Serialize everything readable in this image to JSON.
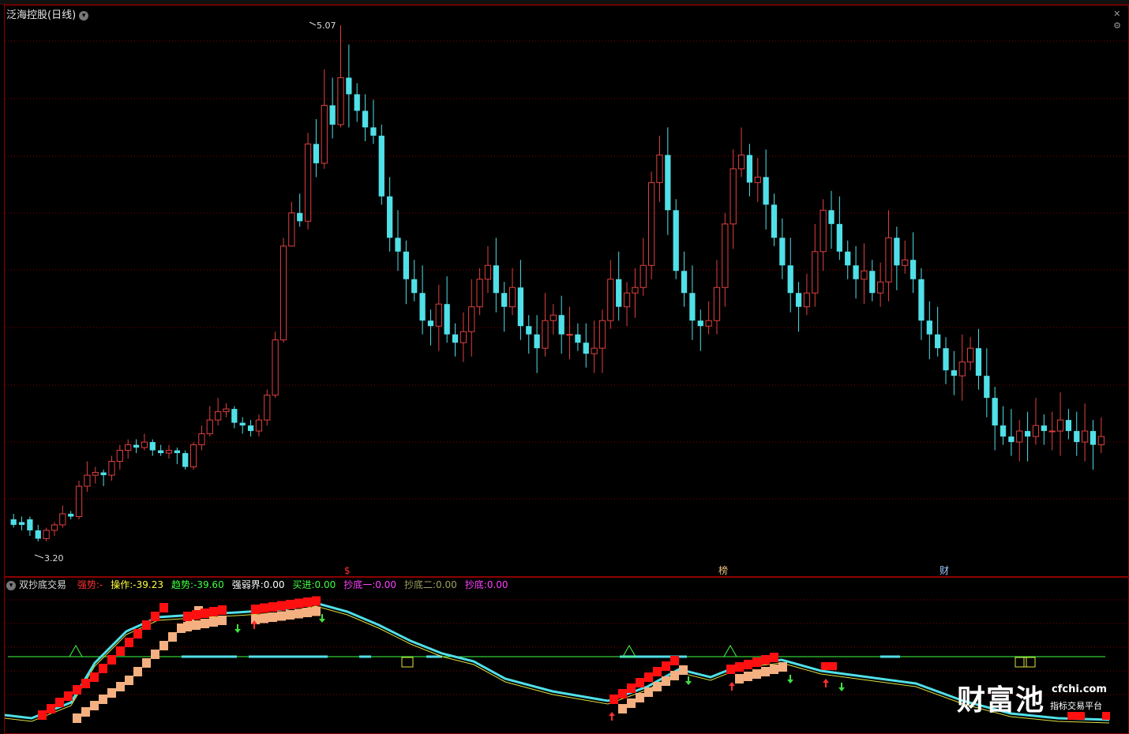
{
  "main": {
    "title": "泛海控股(日线)",
    "high_label": "5.07",
    "low_label": "3.20",
    "markers": [
      {
        "name": "dollar",
        "text": "$",
        "color": "#ff3030"
      },
      {
        "name": "bang",
        "text": "榜",
        "color": "#e8c080"
      },
      {
        "name": "cai",
        "text": "财",
        "color": "#a0c8ff"
      }
    ]
  },
  "sub": {
    "title": "双抄底交易",
    "indicators": [
      {
        "label": "强势:",
        "value": "-",
        "color": "#ff3030"
      },
      {
        "label": "操作:",
        "value": "-39.23",
        "color": "#ffff40"
      },
      {
        "label": "趋势:",
        "value": "-39.60",
        "color": "#40ff40"
      },
      {
        "label": "强弱界:",
        "value": "0.00",
        "color": "#ffffff"
      },
      {
        "label": "买进:",
        "value": "0.00",
        "color": "#40ff40"
      },
      {
        "label": "抄底一:",
        "value": "0.00",
        "color": "#ff40ff"
      },
      {
        "label": "抄底二:",
        "value": "0.00",
        "color": "#a0a060"
      },
      {
        "label": "抄底:",
        "value": "0.00",
        "color": "#ff40ff"
      }
    ]
  },
  "watermark": {
    "brand": "财富池",
    "url": "cfchi.com",
    "tagline": "指标交易平台"
  },
  "colors": {
    "up": "#e04040",
    "down": "#50e0e8",
    "grid": "#8b0000",
    "level_line": "#40ff40"
  },
  "chart_data": {
    "type": "candlestick",
    "high": 5.07,
    "low": 3.2,
    "candles_approx": [
      [
        3.28,
        3.26,
        3.3,
        3.25
      ],
      [
        3.27,
        3.26,
        3.29,
        3.24
      ],
      [
        3.28,
        3.24,
        3.29,
        3.22
      ],
      [
        3.24,
        3.21,
        3.26,
        3.2
      ],
      [
        3.21,
        3.24,
        3.25,
        3.2
      ],
      [
        3.24,
        3.26,
        3.27,
        3.22
      ],
      [
        3.26,
        3.3,
        3.33,
        3.25
      ],
      [
        3.3,
        3.29,
        3.31,
        3.28
      ],
      [
        3.29,
        3.4,
        3.42,
        3.28
      ],
      [
        3.4,
        3.44,
        3.49,
        3.38
      ],
      [
        3.44,
        3.45,
        3.47,
        3.41
      ],
      [
        3.45,
        3.44,
        3.46,
        3.4
      ],
      [
        3.44,
        3.49,
        3.51,
        3.42
      ],
      [
        3.49,
        3.53,
        3.55,
        3.46
      ],
      [
        3.53,
        3.55,
        3.57,
        3.5
      ],
      [
        3.55,
        3.54,
        3.57,
        3.52
      ],
      [
        3.54,
        3.56,
        3.59,
        3.53
      ],
      [
        3.56,
        3.53,
        3.57,
        3.51
      ],
      [
        3.53,
        3.52,
        3.55,
        3.51
      ],
      [
        3.52,
        3.53,
        3.55,
        3.5
      ],
      [
        3.53,
        3.52,
        3.54,
        3.48
      ],
      [
        3.52,
        3.47,
        3.53,
        3.46
      ],
      [
        3.47,
        3.55,
        3.56,
        3.46
      ],
      [
        3.55,
        3.59,
        3.62,
        3.53
      ],
      [
        3.59,
        3.64,
        3.69,
        3.58
      ],
      [
        3.64,
        3.67,
        3.72,
        3.62
      ],
      [
        3.67,
        3.68,
        3.7,
        3.65
      ],
      [
        3.68,
        3.63,
        3.69,
        3.61
      ],
      [
        3.63,
        3.62,
        3.65,
        3.59
      ],
      [
        3.62,
        3.6,
        3.64,
        3.58
      ],
      [
        3.6,
        3.64,
        3.66,
        3.58
      ],
      [
        3.64,
        3.73,
        3.75,
        3.62
      ],
      [
        3.73,
        3.93,
        3.96,
        3.72
      ],
      [
        3.93,
        4.27,
        4.3,
        3.92
      ],
      [
        4.27,
        4.39,
        4.43,
        4.27
      ],
      [
        4.39,
        4.36,
        4.46,
        4.34
      ],
      [
        4.36,
        4.64,
        4.68,
        4.33
      ],
      [
        4.64,
        4.57,
        4.73,
        4.52
      ],
      [
        4.57,
        4.78,
        4.91,
        4.55
      ],
      [
        4.78,
        4.71,
        4.88,
        4.66
      ],
      [
        4.71,
        4.88,
        5.07,
        4.7
      ],
      [
        4.88,
        4.82,
        5.0,
        4.7
      ],
      [
        4.82,
        4.76,
        4.86,
        4.72
      ],
      [
        4.76,
        4.7,
        4.82,
        4.65
      ],
      [
        4.7,
        4.67,
        4.8,
        4.64
      ]
    ]
  }
}
